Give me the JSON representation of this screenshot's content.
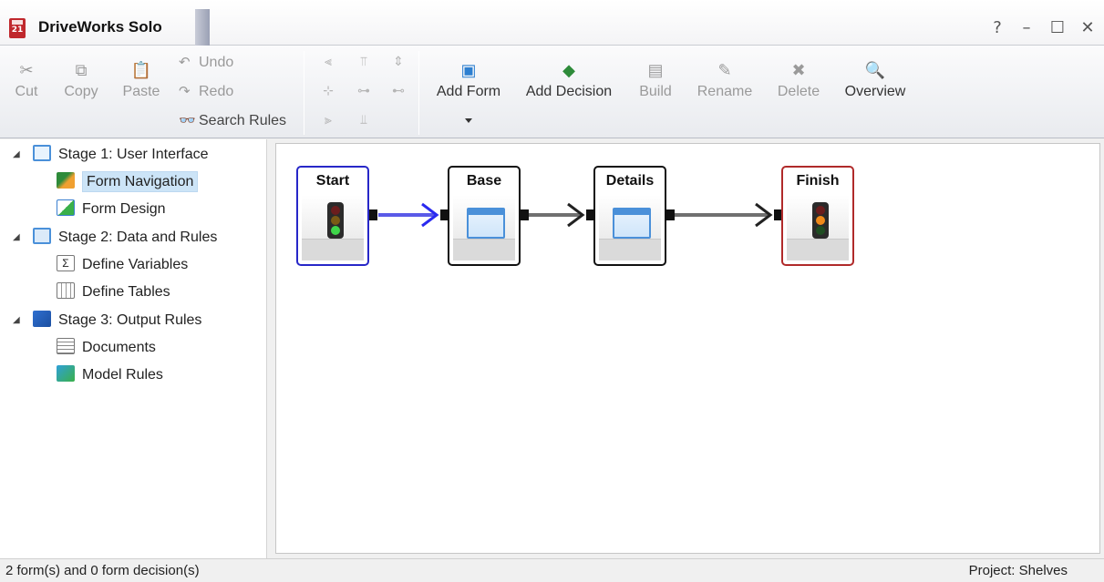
{
  "window": {
    "title": "DriveWorks Solo",
    "controls": {
      "help": "?",
      "minimize": "–",
      "maximize": "☐",
      "close": "✕"
    }
  },
  "ribbon": {
    "clipboard": [
      {
        "label": "Cut",
        "icon": "scissors-icon",
        "enabled": false
      },
      {
        "label": "Copy",
        "icon": "copy-icon",
        "enabled": false
      },
      {
        "label": "Paste",
        "icon": "paste-icon",
        "enabled": false
      }
    ],
    "history": [
      {
        "label": "Undo",
        "icon": "undo-icon",
        "enabled": false
      },
      {
        "label": "Redo",
        "icon": "redo-icon",
        "enabled": false
      },
      {
        "label": "Search Rules",
        "icon": "binoculars-icon",
        "enabled": true
      }
    ],
    "actions": [
      {
        "label": "Add Form",
        "icon": "add-form-icon",
        "enabled": true
      },
      {
        "label": "Add Decision",
        "icon": "add-decision-icon",
        "enabled": true
      },
      {
        "label": "Build",
        "icon": "build-icon",
        "enabled": false
      },
      {
        "label": "Rename",
        "icon": "rename-icon",
        "enabled": false
      },
      {
        "label": "Delete",
        "icon": "delete-icon",
        "enabled": false
      },
      {
        "label": "Overview",
        "icon": "overview-icon",
        "enabled": true
      }
    ]
  },
  "tree": {
    "stages": [
      {
        "label": "Stage 1: User Interface",
        "children": [
          {
            "label": "Form Navigation",
            "selected": true
          },
          {
            "label": "Form Design",
            "selected": false
          }
        ]
      },
      {
        "label": "Stage 2: Data and Rules",
        "children": [
          {
            "label": "Define Variables",
            "selected": false
          },
          {
            "label": "Define Tables",
            "selected": false
          }
        ]
      },
      {
        "label": "Stage 3: Output Rules",
        "children": [
          {
            "label": "Documents",
            "selected": false
          },
          {
            "label": "Model Rules",
            "selected": false
          }
        ]
      }
    ]
  },
  "flow": {
    "nodes": [
      {
        "label": "Start",
        "kind": "start"
      },
      {
        "label": "Base",
        "kind": "form"
      },
      {
        "label": "Details",
        "kind": "form"
      },
      {
        "label": "Finish",
        "kind": "finish"
      }
    ],
    "colors": {
      "start_border": "#2727c8",
      "finish_border": "#b02a2a",
      "start_link": "#5a5ae8",
      "link": "#707070"
    }
  },
  "status": {
    "left": "2 form(s) and 0 form decision(s)",
    "right": "Project: Shelves"
  }
}
